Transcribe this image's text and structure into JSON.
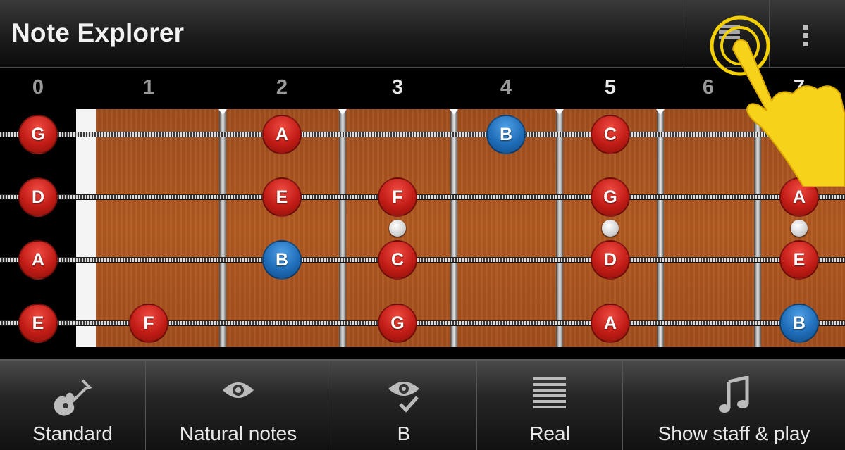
{
  "app": {
    "title": "Note Explorer"
  },
  "actionbar": {
    "list_icon": "list-icon",
    "overflow_icon": "overflow-menu-icon"
  },
  "fret_numbers": [
    "0",
    "1",
    "2",
    "3",
    "4",
    "5",
    "6",
    "7"
  ],
  "fretboard": {
    "strings": [
      {
        "open": "G",
        "notes": [
          {
            "fret": 0,
            "label": "G",
            "color": "red"
          },
          {
            "fret": 2,
            "label": "A",
            "color": "red"
          },
          {
            "fret": 4,
            "label": "B",
            "color": "blue"
          },
          {
            "fret": 5,
            "label": "C",
            "color": "red"
          }
        ]
      },
      {
        "open": "D",
        "notes": [
          {
            "fret": 0,
            "label": "D",
            "color": "red"
          },
          {
            "fret": 2,
            "label": "E",
            "color": "red"
          },
          {
            "fret": 3,
            "label": "F",
            "color": "red"
          },
          {
            "fret": 5,
            "label": "G",
            "color": "red"
          },
          {
            "fret": 7,
            "label": "A",
            "color": "red"
          }
        ]
      },
      {
        "open": "A",
        "notes": [
          {
            "fret": 0,
            "label": "A",
            "color": "red"
          },
          {
            "fret": 2,
            "label": "B",
            "color": "blue"
          },
          {
            "fret": 3,
            "label": "C",
            "color": "red"
          },
          {
            "fret": 5,
            "label": "D",
            "color": "red"
          },
          {
            "fret": 7,
            "label": "E",
            "color": "red"
          }
        ]
      },
      {
        "open": "E",
        "notes": [
          {
            "fret": 0,
            "label": "E",
            "color": "red"
          },
          {
            "fret": 1,
            "label": "F",
            "color": "red"
          },
          {
            "fret": 3,
            "label": "G",
            "color": "red"
          },
          {
            "fret": 5,
            "label": "A",
            "color": "red"
          },
          {
            "fret": 7,
            "label": "B",
            "color": "blue"
          }
        ]
      }
    ],
    "inlay_frets": [
      3,
      5,
      7
    ],
    "colors": {
      "natural": "#c21c16",
      "highlight": "#1f6db8",
      "wood": "#b45b22"
    }
  },
  "bottombar": {
    "buttons": [
      {
        "label": "Standard",
        "icon": "guitar-icon"
      },
      {
        "label": "Natural notes",
        "icon": "eye-icon"
      },
      {
        "label": "B",
        "icon": "eye-check-icon"
      },
      {
        "label": "Real",
        "icon": "lines-icon"
      },
      {
        "label": "Show staff & play",
        "icon": "music-note-icon"
      }
    ]
  }
}
